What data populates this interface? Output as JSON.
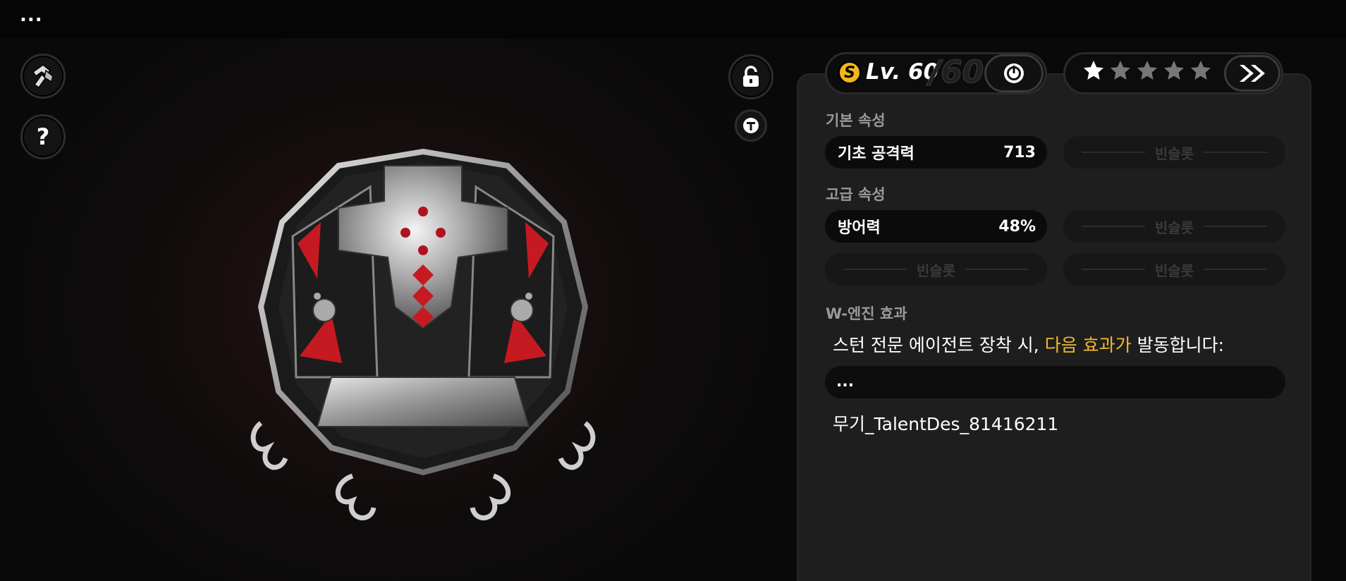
{
  "topbar": {
    "menu_label": "..."
  },
  "weapon": {
    "rank": "S",
    "level_label": "Lv. 60",
    "level_max": "/60",
    "stars_filled": 1,
    "stars_total": 5
  },
  "base_stats": {
    "title": "기본 속성",
    "rows": [
      {
        "label": "기초 공격력",
        "value": "713"
      }
    ],
    "empty_slot_label": "빈슬롯"
  },
  "advanced_stats": {
    "title": "고급 속성",
    "rows": [
      {
        "label": "방어력",
        "value": "48%"
      }
    ],
    "empty_slot_label": "빈슬롯"
  },
  "effect": {
    "title": "W-엔진 효과",
    "description_prefix": "스턴 전문 에이전트 장착 시, ",
    "description_highlight": "다음 효과가",
    "description_suffix": " 발동합니다:",
    "placeholder": "...",
    "talent_text": "무기_TalentDes_81416211"
  },
  "colors": {
    "highlight": "#f5b92e",
    "rank_badge": "#f2b51a"
  },
  "icons": {
    "top_left_1": "hammer-icon",
    "top_left_2": "help-icon",
    "lock": "unlock-icon",
    "tag": "t-icon",
    "power": "power-icon",
    "next": "double-chevron-right-icon"
  }
}
